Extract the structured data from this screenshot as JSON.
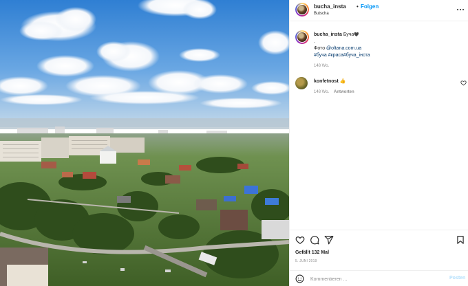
{
  "header": {
    "username": "bucha_insta",
    "separator": "•",
    "follow_label": "Folgen",
    "location": "Butscha",
    "more_icon": "more-horizontal-icon"
  },
  "caption": {
    "username": "bucha_insta",
    "text": "Буча",
    "heart": "🖤",
    "dot_line": ".",
    "photo_prefix": "Фото",
    "photo_credit": "@oltana.com.ua",
    "hashtags": "#буча #краса#буча_інста",
    "time": "148 Wo."
  },
  "comment": {
    "username": "konfetnost",
    "text": "👍",
    "time": "148 Wo.",
    "reply_label": "Antworten",
    "like_icon": "heart-outline-icon"
  },
  "actions": {
    "icons": [
      "heart-outline-icon",
      "comment-icon",
      "share-icon",
      "bookmark-icon"
    ],
    "likes": "Gefällt 132 Mal",
    "date": "5. JUNI 2019"
  },
  "add_comment": {
    "emoji_icon": "emoji-icon",
    "placeholder": "Kommentieren ...",
    "post_label": "Posten"
  },
  "colors": {
    "accent": "#0095f6",
    "post_disabled": "#b2dffc",
    "text": "#262626",
    "muted": "#8e8e8e"
  }
}
